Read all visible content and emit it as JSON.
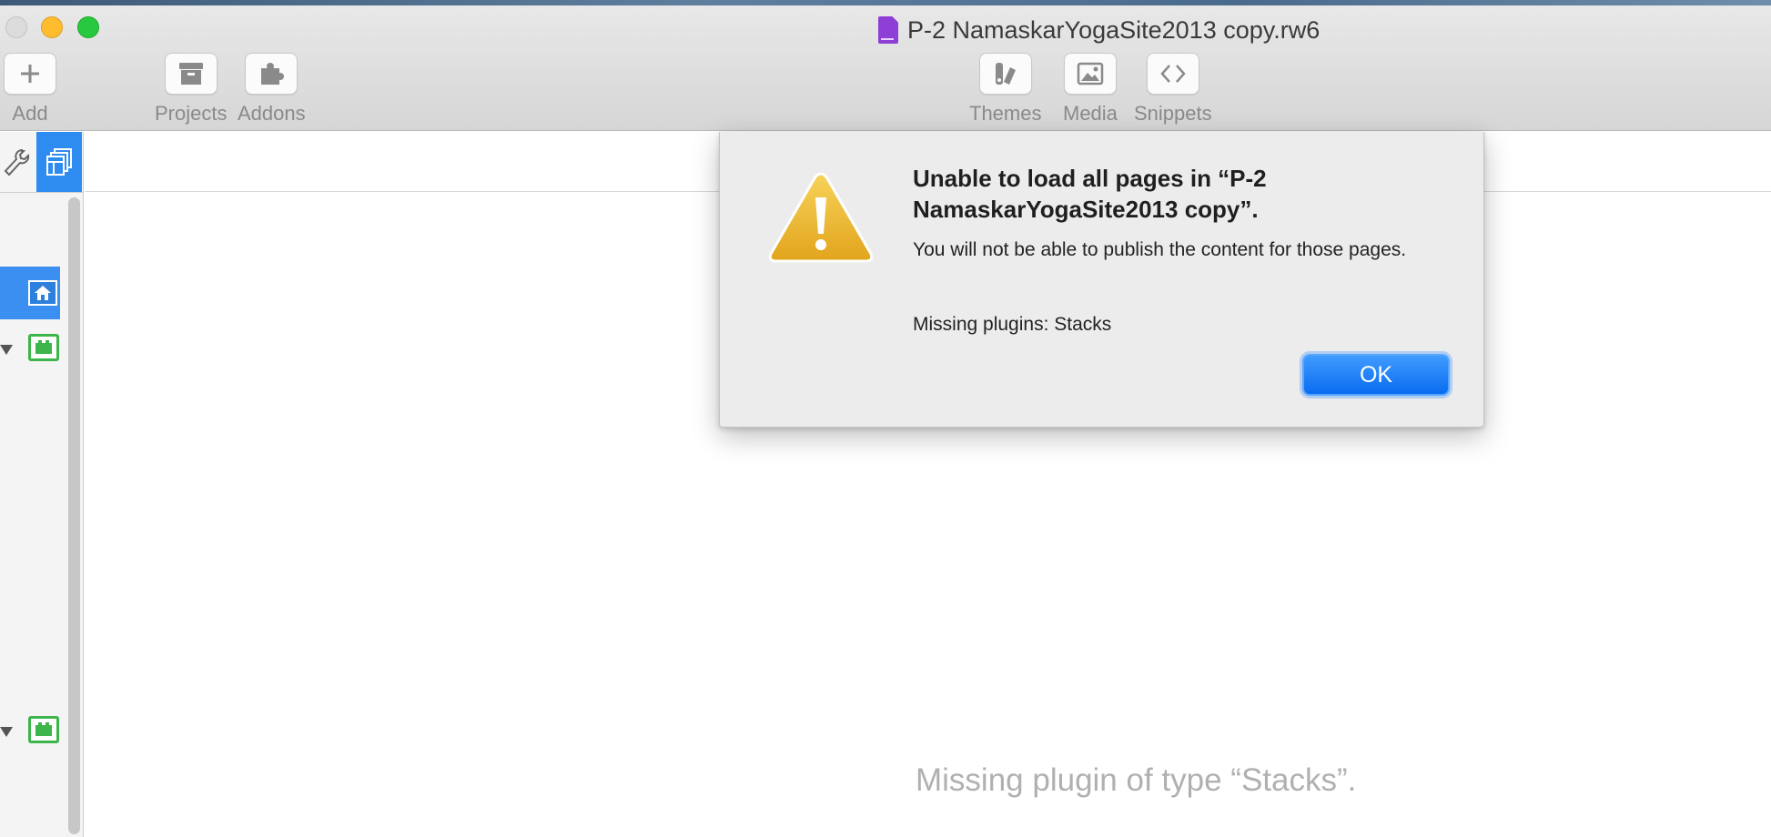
{
  "window": {
    "title": "P-2 NamaskarYogaSite2013 copy.rw6"
  },
  "toolbar": {
    "left": [
      {
        "label": "Add",
        "icon": "plus-icon"
      },
      {
        "label": "Projects",
        "icon": "archive-box-icon"
      },
      {
        "label": "Addons",
        "icon": "puzzle-piece-icon"
      }
    ],
    "center": [
      {
        "label": "Themes",
        "icon": "themes-icon"
      },
      {
        "label": "Media",
        "icon": "image-icon"
      },
      {
        "label": "Snippets",
        "icon": "code-brackets-icon"
      }
    ]
  },
  "dialog": {
    "title": "Unable to load all pages in “P-2 NamaskarYogaSite2013 copy”.",
    "message": "You will not be able to publish the content for those pages.",
    "plugins": "Missing plugins: Stacks",
    "ok_label": "OK"
  },
  "content": {
    "missing_plugin_text": "Missing plugin of type “Stacks”."
  },
  "colors": {
    "accent": "#2e8bf0",
    "page_icon": "#3cb54a",
    "warning": "#f0b72a"
  }
}
